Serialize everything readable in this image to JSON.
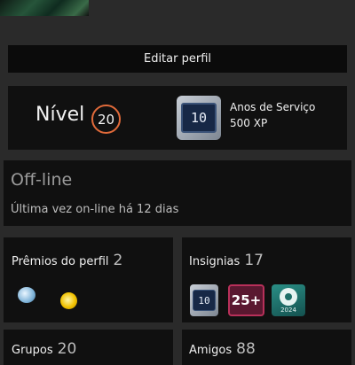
{
  "profile": {
    "edit_label": "Editar perfil"
  },
  "level": {
    "label": "Nível",
    "value": "20"
  },
  "years_badge": {
    "number": "10",
    "title": "Anos de Serviço",
    "xp": "500 XP"
  },
  "status": {
    "title": "Off-line",
    "last_online": "Última vez on-line há 12 dias"
  },
  "awards": {
    "title": "Prêmios do perfil",
    "count": "2",
    "items": [
      "ice-award-icon",
      "sun-award-icon"
    ]
  },
  "badges": {
    "title": "Insignias",
    "count": "17",
    "items": [
      {
        "icon": "years-of-service-badge-icon",
        "text": "10"
      },
      {
        "icon": "level-25-badge-icon",
        "text": "25+"
      },
      {
        "icon": "steam-2024-badge-icon",
        "text": "2024"
      }
    ]
  },
  "groups": {
    "title": "Grupos",
    "count": "20"
  },
  "friends": {
    "title": "Amigos",
    "count": "88"
  },
  "colors": {
    "background": "#2a2a2a",
    "panel": "#101010",
    "level_ring": "#e06a3a"
  }
}
